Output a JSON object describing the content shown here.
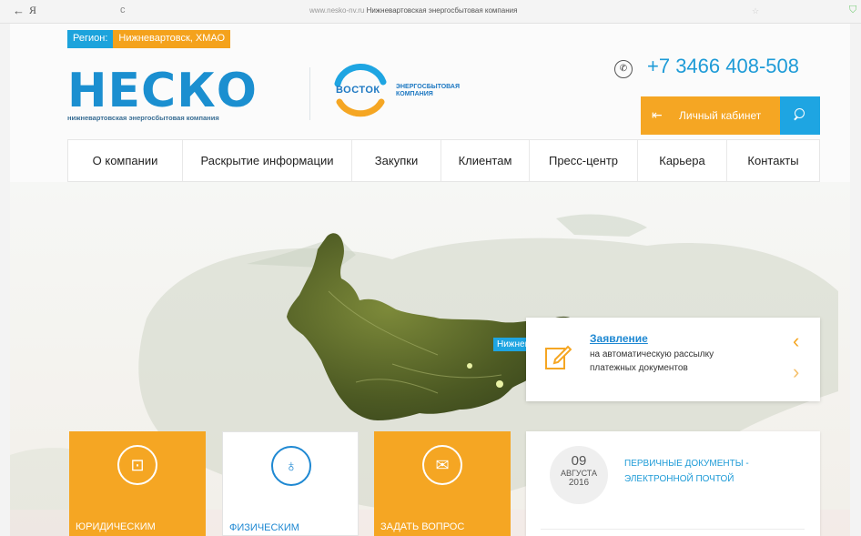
{
  "browser": {
    "back_icon": "←",
    "ya_glyph": "Я",
    "reload_icon": "c",
    "url_domain": "www.nesko-nv.ru",
    "url_title": "Нижневартовская энергосбытовая компания"
  },
  "region": {
    "label": "Регион:",
    "value": "Нижневартовск, ХМАО"
  },
  "logo": {
    "word": "НЕСКО",
    "subtitle": "нижневартовская энергосбытовая компания",
    "partner_name": "ВОСТОК",
    "partner_subtitle": "ЭНЕРГОСБЫТОВАЯ КОМПАНИЯ"
  },
  "contact": {
    "phone": "+7 3466 408-508",
    "cabinet_label": "Личный кабинет"
  },
  "nav": [
    {
      "label": "О компании"
    },
    {
      "label": "Раскрытие информации"
    },
    {
      "label": "Закупки"
    },
    {
      "label": "Клиентам"
    },
    {
      "label": "Пресс-центр"
    },
    {
      "label": "Карьера"
    },
    {
      "label": "Контакты"
    }
  ],
  "map": {
    "city_label": "Нижневартовск"
  },
  "notice": {
    "title": "Заявление",
    "line1": "на автоматическую рассылку",
    "line2": "платежных документов",
    "prev_icon": "‹",
    "next_icon": "›"
  },
  "tiles": [
    {
      "label": "Юридическим",
      "icon": "briefcase-icon"
    },
    {
      "label": "Физическим",
      "icon": "bulb-icon"
    },
    {
      "label": "Задать вопрос",
      "icon": "envelope-icon"
    }
  ],
  "news": {
    "day": "09",
    "month": "Августа",
    "year": "2016",
    "headline": "Первичные документы - электронной почтой"
  },
  "colors": {
    "blue": "#1ea5e2",
    "orange": "#f5a623",
    "logo_blue": "#1b8fd0"
  }
}
